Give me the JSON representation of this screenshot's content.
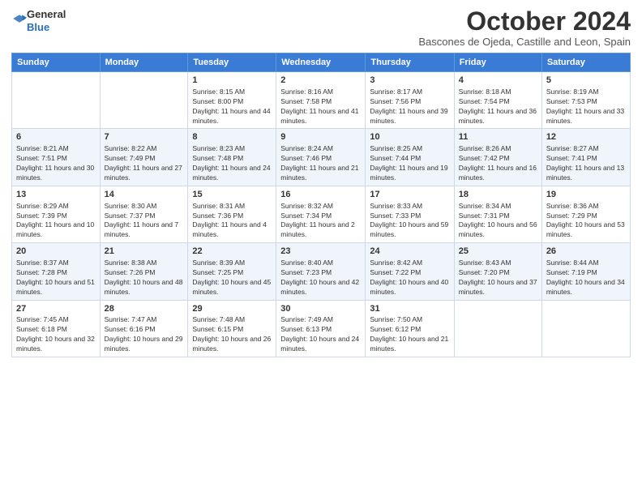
{
  "logo": {
    "general": "General",
    "blue": "Blue"
  },
  "header": {
    "month_title": "October 2024",
    "location": "Bascones de Ojeda, Castille and Leon, Spain"
  },
  "days_of_week": [
    "Sunday",
    "Monday",
    "Tuesday",
    "Wednesday",
    "Thursday",
    "Friday",
    "Saturday"
  ],
  "weeks": [
    [
      {
        "day": "",
        "sunrise": "",
        "sunset": "",
        "daylight": ""
      },
      {
        "day": "",
        "sunrise": "",
        "sunset": "",
        "daylight": ""
      },
      {
        "day": "1",
        "sunrise": "Sunrise: 8:15 AM",
        "sunset": "Sunset: 8:00 PM",
        "daylight": "Daylight: 11 hours and 44 minutes."
      },
      {
        "day": "2",
        "sunrise": "Sunrise: 8:16 AM",
        "sunset": "Sunset: 7:58 PM",
        "daylight": "Daylight: 11 hours and 41 minutes."
      },
      {
        "day": "3",
        "sunrise": "Sunrise: 8:17 AM",
        "sunset": "Sunset: 7:56 PM",
        "daylight": "Daylight: 11 hours and 39 minutes."
      },
      {
        "day": "4",
        "sunrise": "Sunrise: 8:18 AM",
        "sunset": "Sunset: 7:54 PM",
        "daylight": "Daylight: 11 hours and 36 minutes."
      },
      {
        "day": "5",
        "sunrise": "Sunrise: 8:19 AM",
        "sunset": "Sunset: 7:53 PM",
        "daylight": "Daylight: 11 hours and 33 minutes."
      }
    ],
    [
      {
        "day": "6",
        "sunrise": "Sunrise: 8:21 AM",
        "sunset": "Sunset: 7:51 PM",
        "daylight": "Daylight: 11 hours and 30 minutes."
      },
      {
        "day": "7",
        "sunrise": "Sunrise: 8:22 AM",
        "sunset": "Sunset: 7:49 PM",
        "daylight": "Daylight: 11 hours and 27 minutes."
      },
      {
        "day": "8",
        "sunrise": "Sunrise: 8:23 AM",
        "sunset": "Sunset: 7:48 PM",
        "daylight": "Daylight: 11 hours and 24 minutes."
      },
      {
        "day": "9",
        "sunrise": "Sunrise: 8:24 AM",
        "sunset": "Sunset: 7:46 PM",
        "daylight": "Daylight: 11 hours and 21 minutes."
      },
      {
        "day": "10",
        "sunrise": "Sunrise: 8:25 AM",
        "sunset": "Sunset: 7:44 PM",
        "daylight": "Daylight: 11 hours and 19 minutes."
      },
      {
        "day": "11",
        "sunrise": "Sunrise: 8:26 AM",
        "sunset": "Sunset: 7:42 PM",
        "daylight": "Daylight: 11 hours and 16 minutes."
      },
      {
        "day": "12",
        "sunrise": "Sunrise: 8:27 AM",
        "sunset": "Sunset: 7:41 PM",
        "daylight": "Daylight: 11 hours and 13 minutes."
      }
    ],
    [
      {
        "day": "13",
        "sunrise": "Sunrise: 8:29 AM",
        "sunset": "Sunset: 7:39 PM",
        "daylight": "Daylight: 11 hours and 10 minutes."
      },
      {
        "day": "14",
        "sunrise": "Sunrise: 8:30 AM",
        "sunset": "Sunset: 7:37 PM",
        "daylight": "Daylight: 11 hours and 7 minutes."
      },
      {
        "day": "15",
        "sunrise": "Sunrise: 8:31 AM",
        "sunset": "Sunset: 7:36 PM",
        "daylight": "Daylight: 11 hours and 4 minutes."
      },
      {
        "day": "16",
        "sunrise": "Sunrise: 8:32 AM",
        "sunset": "Sunset: 7:34 PM",
        "daylight": "Daylight: 11 hours and 2 minutes."
      },
      {
        "day": "17",
        "sunrise": "Sunrise: 8:33 AM",
        "sunset": "Sunset: 7:33 PM",
        "daylight": "Daylight: 10 hours and 59 minutes."
      },
      {
        "day": "18",
        "sunrise": "Sunrise: 8:34 AM",
        "sunset": "Sunset: 7:31 PM",
        "daylight": "Daylight: 10 hours and 56 minutes."
      },
      {
        "day": "19",
        "sunrise": "Sunrise: 8:36 AM",
        "sunset": "Sunset: 7:29 PM",
        "daylight": "Daylight: 10 hours and 53 minutes."
      }
    ],
    [
      {
        "day": "20",
        "sunrise": "Sunrise: 8:37 AM",
        "sunset": "Sunset: 7:28 PM",
        "daylight": "Daylight: 10 hours and 51 minutes."
      },
      {
        "day": "21",
        "sunrise": "Sunrise: 8:38 AM",
        "sunset": "Sunset: 7:26 PM",
        "daylight": "Daylight: 10 hours and 48 minutes."
      },
      {
        "day": "22",
        "sunrise": "Sunrise: 8:39 AM",
        "sunset": "Sunset: 7:25 PM",
        "daylight": "Daylight: 10 hours and 45 minutes."
      },
      {
        "day": "23",
        "sunrise": "Sunrise: 8:40 AM",
        "sunset": "Sunset: 7:23 PM",
        "daylight": "Daylight: 10 hours and 42 minutes."
      },
      {
        "day": "24",
        "sunrise": "Sunrise: 8:42 AM",
        "sunset": "Sunset: 7:22 PM",
        "daylight": "Daylight: 10 hours and 40 minutes."
      },
      {
        "day": "25",
        "sunrise": "Sunrise: 8:43 AM",
        "sunset": "Sunset: 7:20 PM",
        "daylight": "Daylight: 10 hours and 37 minutes."
      },
      {
        "day": "26",
        "sunrise": "Sunrise: 8:44 AM",
        "sunset": "Sunset: 7:19 PM",
        "daylight": "Daylight: 10 hours and 34 minutes."
      }
    ],
    [
      {
        "day": "27",
        "sunrise": "Sunrise: 7:45 AM",
        "sunset": "Sunset: 6:18 PM",
        "daylight": "Daylight: 10 hours and 32 minutes."
      },
      {
        "day": "28",
        "sunrise": "Sunrise: 7:47 AM",
        "sunset": "Sunset: 6:16 PM",
        "daylight": "Daylight: 10 hours and 29 minutes."
      },
      {
        "day": "29",
        "sunrise": "Sunrise: 7:48 AM",
        "sunset": "Sunset: 6:15 PM",
        "daylight": "Daylight: 10 hours and 26 minutes."
      },
      {
        "day": "30",
        "sunrise": "Sunrise: 7:49 AM",
        "sunset": "Sunset: 6:13 PM",
        "daylight": "Daylight: 10 hours and 24 minutes."
      },
      {
        "day": "31",
        "sunrise": "Sunrise: 7:50 AM",
        "sunset": "Sunset: 6:12 PM",
        "daylight": "Daylight: 10 hours and 21 minutes."
      },
      {
        "day": "",
        "sunrise": "",
        "sunset": "",
        "daylight": ""
      },
      {
        "day": "",
        "sunrise": "",
        "sunset": "",
        "daylight": ""
      }
    ]
  ]
}
